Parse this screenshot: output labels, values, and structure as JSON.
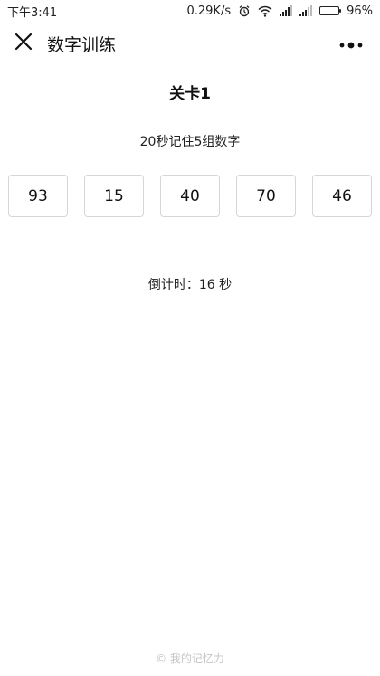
{
  "status_bar": {
    "time": "下午3:41",
    "network_speed": "0.29K/s",
    "battery_percent": "96%",
    "battery_level": 0.96,
    "icons": [
      "alarm-icon",
      "wifi-icon",
      "signal-icon",
      "signal-icon",
      "battery-icon"
    ]
  },
  "nav": {
    "title": "数字训练",
    "close_icon": "close-icon",
    "more_icon": "more-icon"
  },
  "game": {
    "level_title": "关卡1",
    "instruction": "20秒记住5组数字",
    "numbers": [
      "93",
      "15",
      "40",
      "70",
      "46"
    ],
    "countdown_label": "倒计时：",
    "countdown_value": "16",
    "countdown_unit": "秒"
  },
  "footer": {
    "text": "© 我的记忆力"
  }
}
